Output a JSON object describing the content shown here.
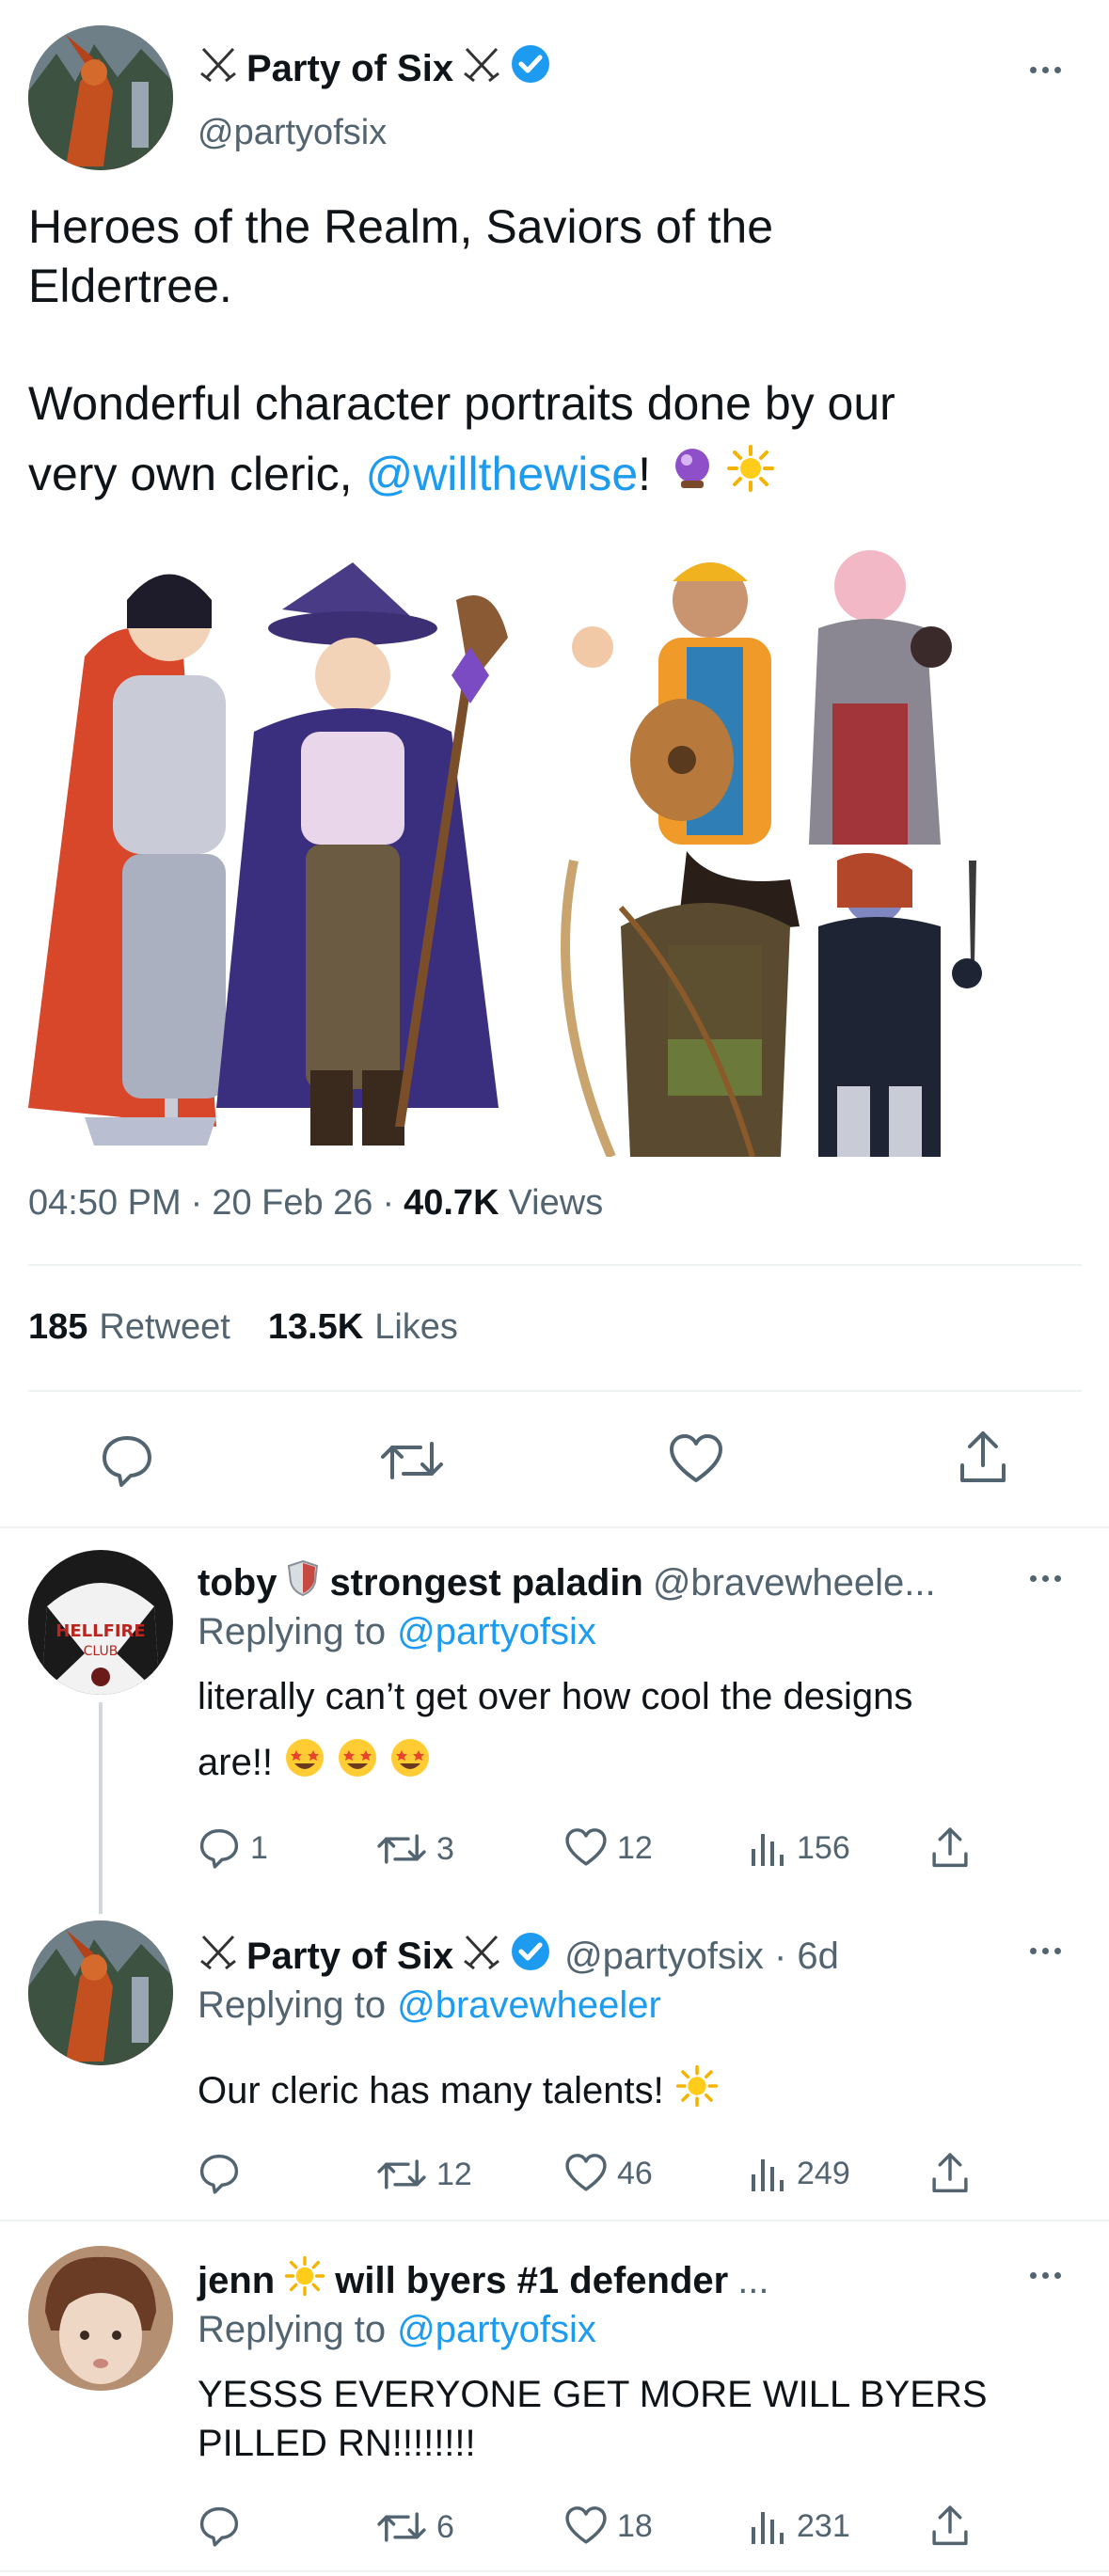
{
  "main_tweet": {
    "display_name": "Party of Six",
    "handle": "@partyofsix",
    "text_line1": "Heroes of the Realm, Saviors of the",
    "text_line2": "Eldertree.",
    "text_line3": "Wonderful character portraits done by our",
    "text_line4_prefix": "very own cleric, ",
    "text_mention": "@willthewise",
    "text_line4_suffix": "!",
    "time": "04:50 PM",
    "sep1": "·",
    "date": "20 Feb 26",
    "sep2": "·",
    "views_count": "40.7K",
    "views_label": "Views",
    "retweet_count": "185",
    "retweet_label": "Retweet",
    "likes_count": "13.5K",
    "likes_label": "Likes"
  },
  "replies": [
    {
      "name_part1": "toby",
      "name_part2": "strongest paladin",
      "handle": "@bravewheele...",
      "replying_to_label": "Replying to",
      "replying_to": "@partyofsix",
      "text_line1": "literally can’t get over how cool the designs",
      "text_line2": "are!!",
      "replies": "1",
      "retweets": "3",
      "likes": "12",
      "views": "156"
    },
    {
      "name": "Party of Six",
      "handle_time": "@partyofsix · 6d",
      "replying_to_label": "Replying to",
      "replying_to": "@bravewheeler",
      "text_line1": "Our cleric has many talents!",
      "replies": "",
      "retweets": "12",
      "likes": "46",
      "views": "249"
    },
    {
      "name_part1": "jenn",
      "name_part2": "will byers #1 defender",
      "ellipsis": "...",
      "replying_to_label": "Replying to",
      "replying_to": "@partyofsix",
      "text_line1": "YESSS EVERYONE GET MORE WILL BYERS",
      "text_line2": "PILLED RN!!!!!!!!",
      "replies": "",
      "retweets": "6",
      "likes": "18",
      "views": "231"
    }
  ],
  "colors": {
    "accent": "#1d9bf0",
    "muted": "#536471",
    "divider": "#eff3f4"
  },
  "icons": [
    "crossed-swords-icon",
    "verified-badge-icon",
    "more-icon",
    "reply-icon",
    "retweet-icon",
    "like-icon",
    "share-icon",
    "views-icon",
    "crystal-ball-emoji",
    "sun-emoji",
    "shield-emoji",
    "star-struck-emoji"
  ]
}
